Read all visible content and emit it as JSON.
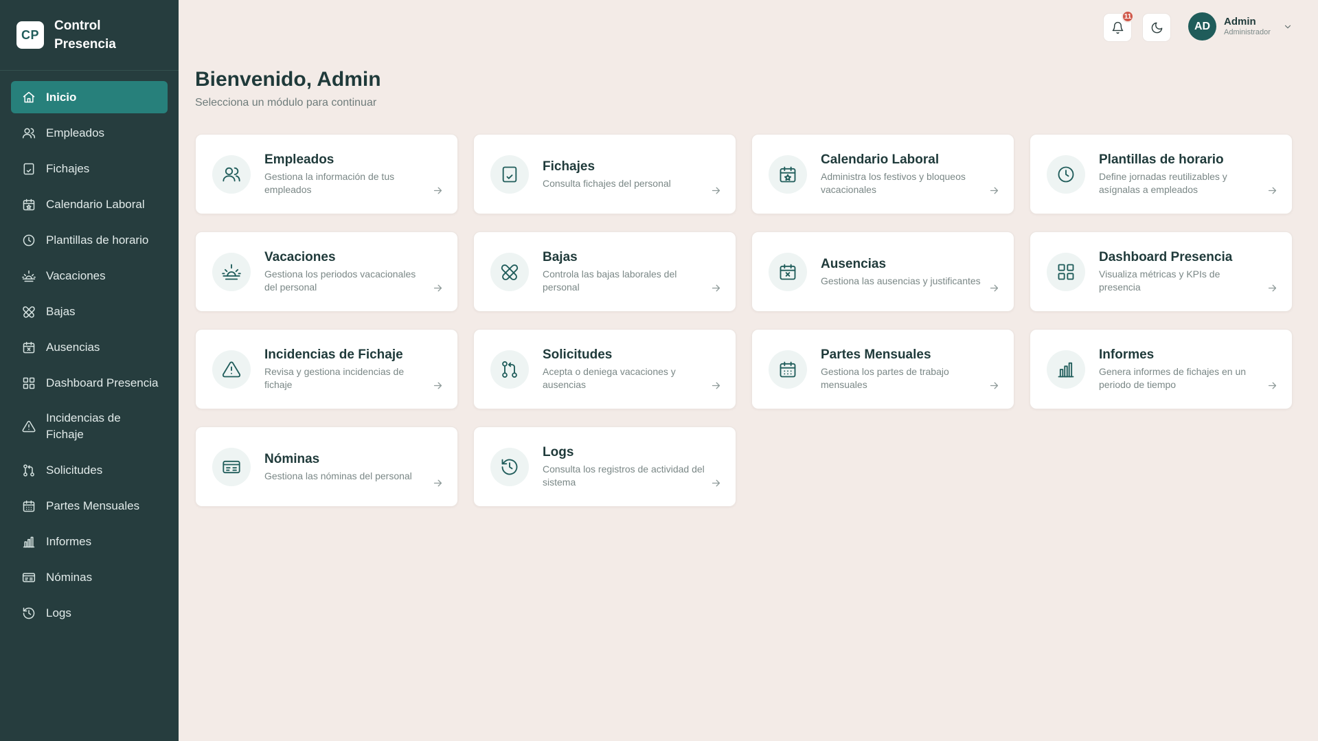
{
  "brand": {
    "logo": "CP",
    "title": "Control Presencia"
  },
  "sidebar": {
    "items": [
      {
        "label": "Inicio",
        "icon": "home-icon",
        "active": true
      },
      {
        "label": "Empleados",
        "icon": "users-icon"
      },
      {
        "label": "Fichajes",
        "icon": "tablet-check-icon"
      },
      {
        "label": "Calendario Laboral",
        "icon": "calendar-star-icon"
      },
      {
        "label": "Plantillas de horario",
        "icon": "clock-icon"
      },
      {
        "label": "Vacaciones",
        "icon": "sunrise-icon"
      },
      {
        "label": "Bajas",
        "icon": "bandage-icon"
      },
      {
        "label": "Ausencias",
        "icon": "calendar-x-icon"
      },
      {
        "label": "Dashboard Presencia",
        "icon": "grid-icon"
      },
      {
        "label": "Incidencias de Fichaje",
        "icon": "alert-triangle-icon"
      },
      {
        "label": "Solicitudes",
        "icon": "git-pull-request-icon"
      },
      {
        "label": "Partes Mensuales",
        "icon": "calendar-grid-icon"
      },
      {
        "label": "Informes",
        "icon": "bar-chart-icon"
      },
      {
        "label": "Nóminas",
        "icon": "payroll-icon"
      },
      {
        "label": "Logs",
        "icon": "history-icon"
      }
    ]
  },
  "topbar": {
    "notifications_count": "11",
    "notifications_icon": "bell-icon",
    "theme_icon": "moon-icon",
    "user": {
      "initials": "AD",
      "name": "Admin",
      "role": "Administrador"
    }
  },
  "main": {
    "title": "Bienvenido, Admin",
    "subtitle": "Selecciona un módulo para continuar",
    "cards": [
      {
        "title": "Empleados",
        "desc": "Gestiona la información de tus empleados",
        "icon": "users-icon"
      },
      {
        "title": "Fichajes",
        "desc": "Consulta fichajes del personal",
        "icon": "tablet-check-icon"
      },
      {
        "title": "Calendario Laboral",
        "desc": "Administra los festivos y bloqueos vacacionales",
        "icon": "calendar-star-icon"
      },
      {
        "title": "Plantillas de horario",
        "desc": "Define jornadas reutilizables y asígnalas a empleados",
        "icon": "clock-icon"
      },
      {
        "title": "Vacaciones",
        "desc": "Gestiona los periodos vacacionales del personal",
        "icon": "sunrise-icon"
      },
      {
        "title": "Bajas",
        "desc": "Controla las bajas laborales del personal",
        "icon": "bandage-icon"
      },
      {
        "title": "Ausencias",
        "desc": "Gestiona las ausencias y justificantes",
        "icon": "calendar-x-icon"
      },
      {
        "title": "Dashboard Presencia",
        "desc": "Visualiza métricas y KPIs de presencia",
        "icon": "grid-icon"
      },
      {
        "title": "Incidencias de Fichaje",
        "desc": "Revisa y gestiona incidencias de fichaje",
        "icon": "alert-triangle-icon"
      },
      {
        "title": "Solicitudes",
        "desc": "Acepta o deniega vacaciones y ausencias",
        "icon": "git-pull-request-icon"
      },
      {
        "title": "Partes Mensuales",
        "desc": "Gestiona los partes de trabajo mensuales",
        "icon": "calendar-grid-icon"
      },
      {
        "title": "Informes",
        "desc": "Genera informes de fichajes en un periodo de tiempo",
        "icon": "bar-chart-icon"
      },
      {
        "title": "Nóminas",
        "desc": "Gestiona las nóminas del personal",
        "icon": "payroll-icon"
      },
      {
        "title": "Logs",
        "desc": "Consulta los registros de actividad del sistema",
        "icon": "history-icon"
      }
    ]
  },
  "colors": {
    "sidebar_bg": "#263d3e",
    "accent": "#27807b",
    "page_bg": "#f3ebe7",
    "badge": "#d0584a"
  }
}
